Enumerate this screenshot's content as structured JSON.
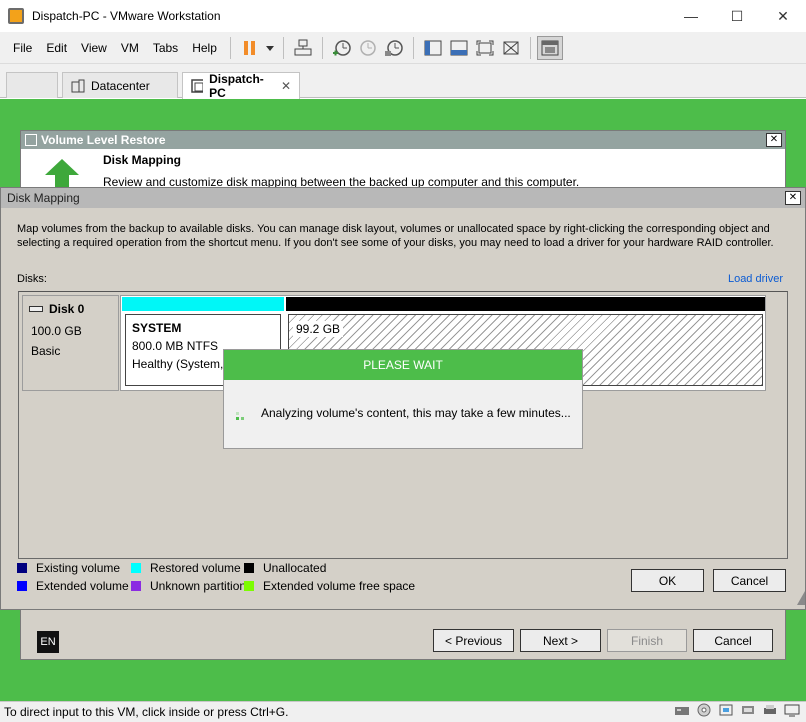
{
  "window": {
    "title": "Dispatch-PC - VMware Workstation",
    "minimize_icon": "minimize-icon",
    "maximize_icon": "maximize-icon",
    "close_icon": "close-icon"
  },
  "menu": {
    "items": [
      "File",
      "Edit",
      "View",
      "VM",
      "Tabs",
      "Help"
    ]
  },
  "tabs": [
    {
      "label": "",
      "icon": "home-icon"
    },
    {
      "label": "Datacenter",
      "icon": "datacenter-icon"
    },
    {
      "label": "Dispatch-PC",
      "icon": "vm-icon",
      "active": true
    }
  ],
  "wizard": {
    "title": "Volume Level Restore",
    "step_title": "Disk Mapping",
    "step_desc": "Review and customize disk mapping between the backed up computer and this computer.",
    "language": "EN",
    "buttons": {
      "previous": "< Previous",
      "next": "Next >",
      "finish": "Finish",
      "cancel": "Cancel"
    }
  },
  "disk_mapping": {
    "title": "Disk Mapping",
    "description": "Map volumes from the backup to available disks. You can manage disk layout, volumes or unallocated space by right-clicking the corresponding object and selecting a required operation from the shortcut menu. If you don't see some of your disks, you may need to load a driver for your hardware RAID controller.",
    "disks_label": "Disks:",
    "load_driver": "Load driver",
    "disk": {
      "name": "Disk 0",
      "size": "100.0 GB",
      "type": "Basic"
    },
    "partitions": {
      "system": {
        "name": "SYSTEM",
        "size": "800.0 MB NTFS",
        "status": "Healthy (System, A"
      },
      "unallocated": {
        "size": "99.2 GB"
      }
    },
    "legend": [
      {
        "label": "Existing volume",
        "color": "#00007f"
      },
      {
        "label": "Restored volume",
        "color": "#00ffff"
      },
      {
        "label": "Unallocated",
        "color": "#000000"
      },
      {
        "label": "Extended volume",
        "color": "#0000ff"
      },
      {
        "label": "Unknown partition",
        "color": "#8b2be2"
      },
      {
        "label": "Extended volume free space",
        "color": "#7cfc00"
      }
    ],
    "buttons": {
      "ok": "OK",
      "cancel": "Cancel"
    }
  },
  "please_wait": {
    "title": "PLEASE WAIT",
    "message": "Analyzing volume's content, this may take a few minutes..."
  },
  "status": {
    "text": "To direct input to this VM, click inside or press Ctrl+G."
  },
  "colors": {
    "accent_green": "#4dbd4a",
    "restored_cyan": "#00f7f7"
  }
}
